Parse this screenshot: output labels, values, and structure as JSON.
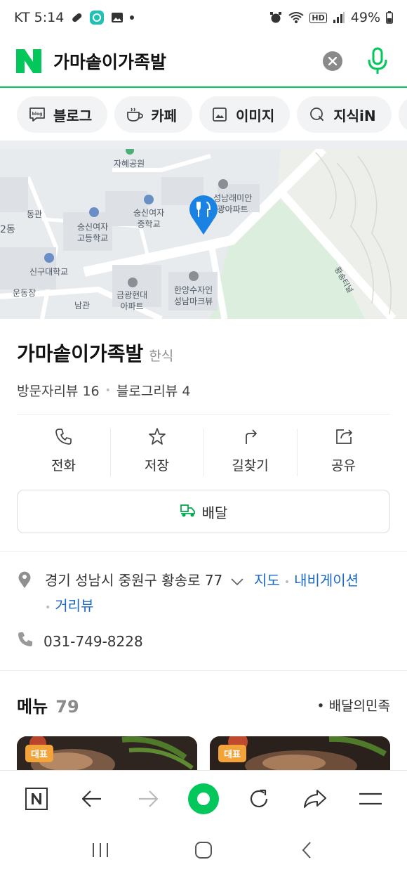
{
  "status_bar": {
    "carrier_time": "KT 5:14",
    "hd_label": "HD",
    "battery": "49%"
  },
  "search": {
    "logo_letter": "N",
    "query": "가마솥이가족발"
  },
  "chips": [
    {
      "label": "블로그",
      "icon": "blog-icon"
    },
    {
      "label": "카페",
      "icon": "cafe-cup-icon"
    },
    {
      "label": "이미지",
      "icon": "image-icon"
    },
    {
      "label": "지식iN",
      "icon": "knowledge-q-icon"
    }
  ],
  "map": {
    "labels": [
      "자혜공원",
      "동관",
      "숭신여자\n중학교",
      "숭신여자\n고등학교",
      "신구대학교",
      "운동장",
      "남관",
      "금광현대\n아파트",
      "한양수자인\n성남마크뷰",
      "성남래미안\n광아파트",
      "2동",
      "황송터널"
    ],
    "marker_icon": "restaurant-marker-icon"
  },
  "place": {
    "name": "가마솥이가족발",
    "category": "한식",
    "visitor_reviews": "방문자리뷰 16",
    "blog_reviews": "블로그리뷰 4"
  },
  "actions": [
    {
      "label": "전화",
      "icon": "phone-icon"
    },
    {
      "label": "저장",
      "icon": "star-icon"
    },
    {
      "label": "길찾기",
      "icon": "directions-icon"
    },
    {
      "label": "공유",
      "icon": "share-icon"
    }
  ],
  "delivery": {
    "label": "배달",
    "icon": "delivery-scooter-icon"
  },
  "address": {
    "text": "경기 성남시 중원구 황송로 77",
    "map_link": "지도",
    "navi_link": "내비게이션",
    "street_link": "거리뷰"
  },
  "phone": "031-749-8228",
  "menu": {
    "title": "메뉴",
    "count": "79",
    "source": "• 배달의민족",
    "badge": "대표"
  },
  "colors": {
    "naver_green": "#03c75a",
    "link_blue": "#1a68c4",
    "map_green": "#dceedd",
    "badge_orange": "#f2a33a"
  }
}
